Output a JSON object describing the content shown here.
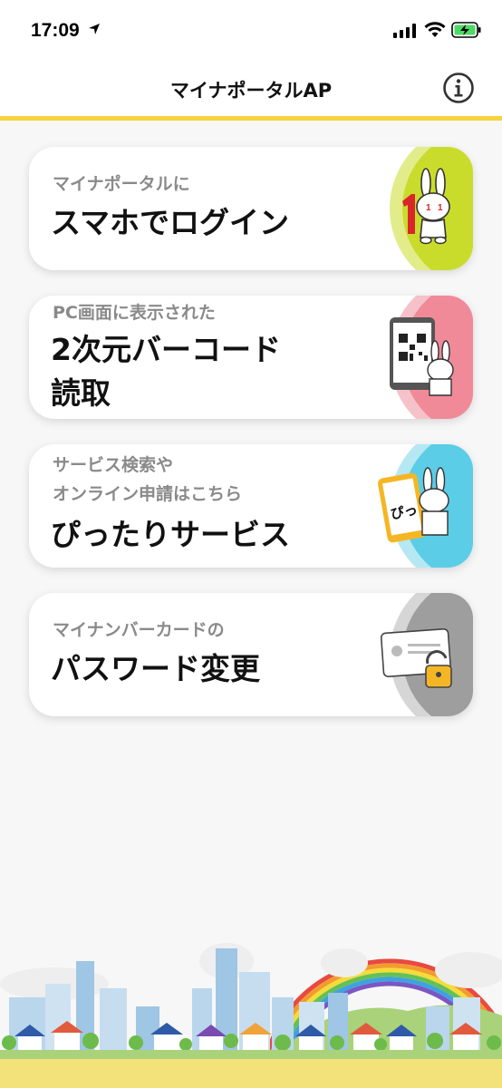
{
  "status_bar": {
    "time": "17:09",
    "icons": [
      "location-arrow-icon",
      "signal-icon",
      "wifi-icon",
      "battery-charging-icon"
    ]
  },
  "nav": {
    "title": "マイナポータルAP",
    "info_icon": "info-icon"
  },
  "accent_color": "#f5d33c",
  "menu": [
    {
      "sub": "マイナポータルに",
      "main": "スマホでログイン",
      "color": "#c9dc2c",
      "icon": "rabbit-login-icon"
    },
    {
      "sub": "PC画面に表示された",
      "main_line1": "2次元バーコード",
      "main_line2": "読取",
      "color": "#f08a98",
      "icon": "qr-scan-icon"
    },
    {
      "sub_line1": "サービス検索や",
      "sub_line2": "オンライン申請はこちら",
      "main": "ぴったりサービス",
      "color": "#5bcde6",
      "icon": "pittari-service-icon",
      "icon_text": "ぴっ"
    },
    {
      "sub": "マイナンバーカードの",
      "main": "パスワード変更",
      "color": "#9e9e9e",
      "icon": "card-lock-icon"
    }
  ]
}
